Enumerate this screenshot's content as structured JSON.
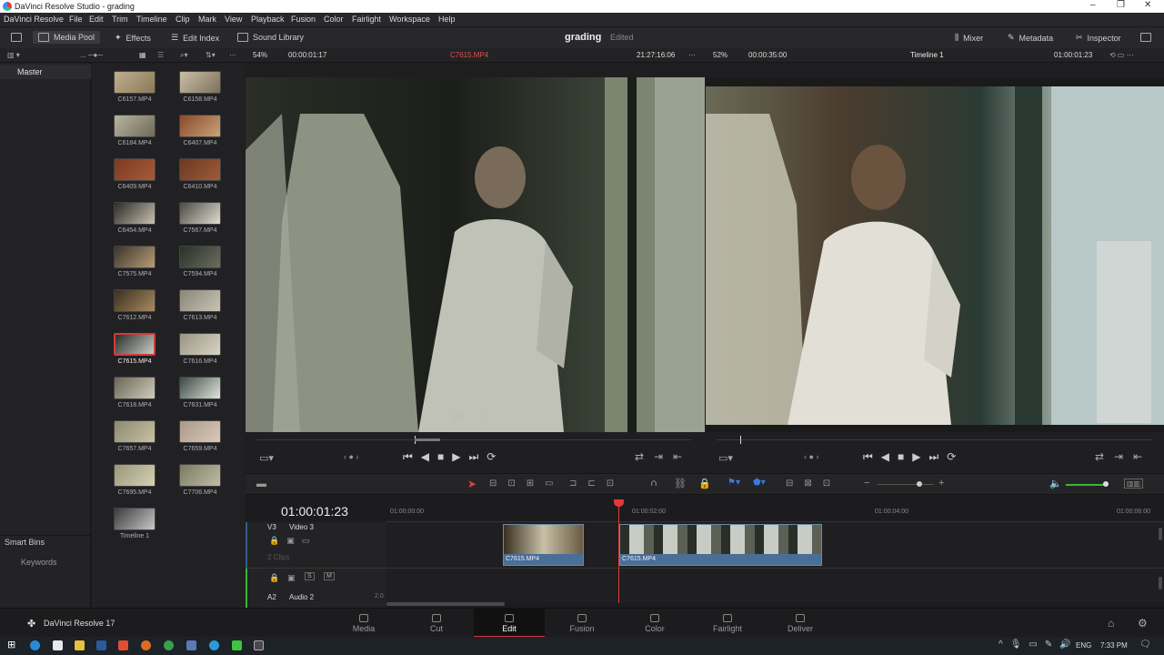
{
  "app": {
    "window_title": "DaVinci Resolve Studio - grading",
    "minimize": "–",
    "maximize": "❐",
    "close": "✕"
  },
  "menu": [
    "DaVinci Resolve",
    "File",
    "Edit",
    "Trim",
    "Timeline",
    "Clip",
    "Mark",
    "View",
    "Playback",
    "Fusion",
    "Color",
    "Fairlight",
    "Workspace",
    "Help"
  ],
  "toolbar": {
    "media_pool": "Media Pool",
    "effects": "Effects",
    "edit_index": "Edit Index",
    "sound_library": "Sound Library",
    "project": "grading",
    "status": "Edited",
    "mixer": "Mixer",
    "metadata": "Metadata",
    "inspector": "Inspector"
  },
  "source_viewer": {
    "zoom": "54%",
    "duration": "00:00:01:17",
    "clip": "C7615.MP4",
    "timecode": "21:27:16:06"
  },
  "timeline_viewer": {
    "zoom": "52%",
    "duration": "00:00:35:00",
    "timeline": "Timeline 1",
    "timecode": "01:00:01:23"
  },
  "left_panel": {
    "master": "Master",
    "smart_bins": "Smart Bins",
    "keywords": "Keywords"
  },
  "clips": [
    {
      "name": "C6157.MP4",
      "c1": "#bfae8e",
      "c2": "#8a7a5a"
    },
    {
      "name": "C6158.MP4",
      "c1": "#c9bfa8",
      "c2": "#7d7058"
    },
    {
      "name": "C6184.MP4",
      "c1": "#b8b4a0",
      "c2": "#6e6a58"
    },
    {
      "name": "C6407.MP4",
      "c1": "#8a4a2a",
      "c2": "#c8a27a"
    },
    {
      "name": "C6409.MP4",
      "c1": "#7a3a22",
      "c2": "#a85a3a"
    },
    {
      "name": "C6410.MP4",
      "c1": "#6a3a22",
      "c2": "#a05a3a"
    },
    {
      "name": "C6454.MP4",
      "c1": "#2a2a28",
      "c2": "#c8c0b0"
    },
    {
      "name": "C7567.MP4",
      "c1": "#4a4a44",
      "c2": "#e0dcd0"
    },
    {
      "name": "C7575.MP4",
      "c1": "#3a3428",
      "c2": "#b89c78"
    },
    {
      "name": "C7594.MP4",
      "c1": "#2a3028",
      "c2": "#6a6e60"
    },
    {
      "name": "C7612.MP4",
      "c1": "#3a3020",
      "c2": "#a88a60"
    },
    {
      "name": "C7613.MP4",
      "c1": "#8a8678",
      "c2": "#c8c4b4"
    },
    {
      "name": "C7615.MP4",
      "c1": "#2a2c28",
      "c2": "#c8ccc4"
    },
    {
      "name": "C7616.MP4",
      "c1": "#9a9482",
      "c2": "#d8d4c4"
    },
    {
      "name": "C7618.MP4",
      "c1": "#6a6654",
      "c2": "#d0ccbc"
    },
    {
      "name": "C7631.MP4",
      "c1": "#3a4a44",
      "c2": "#e0e4dc"
    },
    {
      "name": "C7657.MP4",
      "c1": "#8a8a70",
      "c2": "#c8c0a4"
    },
    {
      "name": "C7659.MP4",
      "c1": "#aa9a8a",
      "c2": "#d8c8b8"
    },
    {
      "name": "C7695.MP4",
      "c1": "#9a9678",
      "c2": "#d4d0b4"
    },
    {
      "name": "C7706.MP4",
      "c1": "#7a7a64",
      "c2": "#c0bca4"
    },
    {
      "name": "Timeline 1",
      "c1": "#3a3a3a",
      "c2": "#c8c8c8"
    }
  ],
  "timeline": {
    "timecode": "01:00:01:23",
    "ruler": [
      "01:00:00:00",
      "01:00:02:00",
      "01:00:04:00",
      "01:00:06:00"
    ],
    "tracks": {
      "v3": "V3",
      "v3_name": "Video 3",
      "v3_count": "2 Clips",
      "a2": "A2",
      "a2_name": "Audio 2",
      "a2_level": "2.0",
      "s": "S",
      "m": "M"
    },
    "clip_labels": [
      "C7615.MP4",
      "C7615.MP4"
    ]
  },
  "pages": [
    {
      "label": "Media",
      "active": false
    },
    {
      "label": "Cut",
      "active": false
    },
    {
      "label": "Edit",
      "active": true
    },
    {
      "label": "Fusion",
      "active": false
    },
    {
      "label": "Color",
      "active": false
    },
    {
      "label": "Fairlight",
      "active": false
    },
    {
      "label": "Deliver",
      "active": false
    }
  ],
  "brand": "DaVinci Resolve 17",
  "taskbar": {
    "lang": "ENG",
    "time": "7:33 PM"
  }
}
